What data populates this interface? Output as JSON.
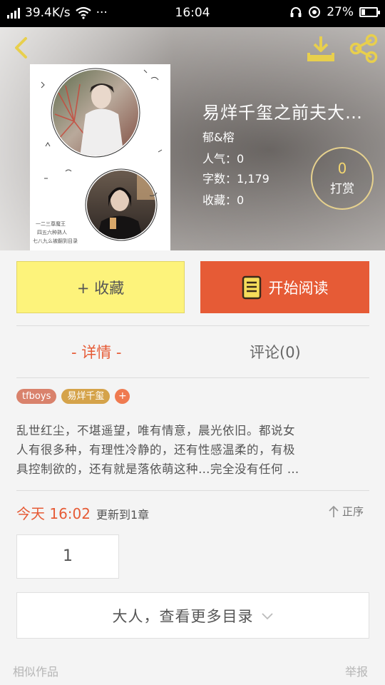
{
  "status_bar": {
    "speed": "39.4K/s",
    "dots": "···",
    "time": "16:04",
    "battery": "27%",
    "battery_level": 0.27
  },
  "book": {
    "title": "易烊千玺之前夫大…",
    "author": "郁&榕",
    "popularity": "人气：0",
    "word_count": "字数：1,179",
    "collections": "收藏：0",
    "tip_count": "0",
    "tip_label": "打赏"
  },
  "cover": {
    "caption_lines": [
      "一二三尊魔王",
      "四五六种熟人",
      "七八九么被翻到目录"
    ]
  },
  "actions": {
    "collect_label": "+ 收藏",
    "read_label": "开始阅读"
  },
  "tabs": [
    {
      "label": "- 详情 -",
      "active": true
    },
    {
      "label": "评论(0)",
      "active": false
    }
  ],
  "tags": [
    "tfboys",
    "易烊千玺"
  ],
  "add_tag_label": "+",
  "synopsis_lines": [
    "乱世红尘，不堪遥望，唯有情意，晨光依旧。都说女",
    "人有很多种，有理性冷静的，还有性感温柔的，有极",
    "具控制欲的，还有就是落依萌这种…完全没有任何 …"
  ],
  "update": {
    "when": "今天 16:02",
    "what": "更新到1章",
    "sort_label": "正序"
  },
  "chapter_number": "1",
  "more_catalog_label": "大人，查看更多目录",
  "footer": {
    "similar": "相似作品",
    "report": "举报"
  },
  "colors": {
    "accent": "#e65b36",
    "collect_bg": "#fdf37b",
    "icon_yellow": "#e8cf4d"
  },
  "icons": [
    "back-icon",
    "download-icon",
    "share-icon",
    "book-icon",
    "chevron-down-icon",
    "sort-up-arrow-icon",
    "wifi-icon",
    "signal-icon",
    "headphone-icon",
    "location-icon",
    "battery-icon"
  ]
}
